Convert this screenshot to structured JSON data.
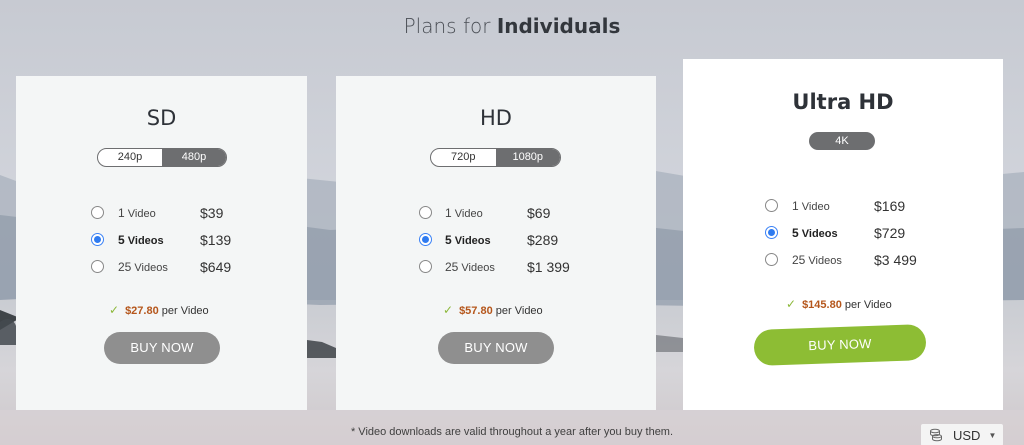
{
  "header": {
    "title_light": "Plans for ",
    "title_bold": "Individuals"
  },
  "plans": [
    {
      "name": "SD",
      "resolutions": [
        "240p",
        "480p"
      ],
      "selected_resolution": "480p",
      "options": [
        {
          "count": "1",
          "unit": "Video",
          "price": "$39",
          "selected": false
        },
        {
          "count": "5",
          "unit": "Videos",
          "price": "$139",
          "selected": true
        },
        {
          "count": "25",
          "unit": "Videos",
          "price": "$649",
          "selected": false
        }
      ],
      "per_video_amount": "$27.80",
      "per_video_suffix": "per Video",
      "button_label": "BUY NOW"
    },
    {
      "name": "HD",
      "resolutions": [
        "720p",
        "1080p"
      ],
      "selected_resolution": "1080p",
      "options": [
        {
          "count": "1",
          "unit": "Video",
          "price": "$69",
          "selected": false
        },
        {
          "count": "5",
          "unit": "Videos",
          "price": "$289",
          "selected": true
        },
        {
          "count": "25",
          "unit": "Videos",
          "price": "$1 399",
          "selected": false
        }
      ],
      "per_video_amount": "$57.80",
      "per_video_suffix": "per Video",
      "button_label": "BUY NOW"
    },
    {
      "name": "Ultra HD",
      "resolution_badge": "4K",
      "options": [
        {
          "count": "1",
          "unit": "Video",
          "price": "$169",
          "selected": false
        },
        {
          "count": "5",
          "unit": "Videos",
          "price": "$729",
          "selected": true
        },
        {
          "count": "25",
          "unit": "Videos",
          "price": "$3 499",
          "selected": false
        }
      ],
      "per_video_amount": "$145.80",
      "per_video_suffix": "per Video",
      "button_label": "BUY NOW"
    }
  ],
  "footnote": "* Video downloads are valid throughout a year after you buy them.",
  "currency": {
    "label": "USD",
    "icon": "coins-icon"
  },
  "colors": {
    "accent_green": "#8dbd34",
    "price_orange": "#b5561b",
    "toggle_grey": "#6d6e70",
    "radio_blue": "#2f7bf0"
  }
}
